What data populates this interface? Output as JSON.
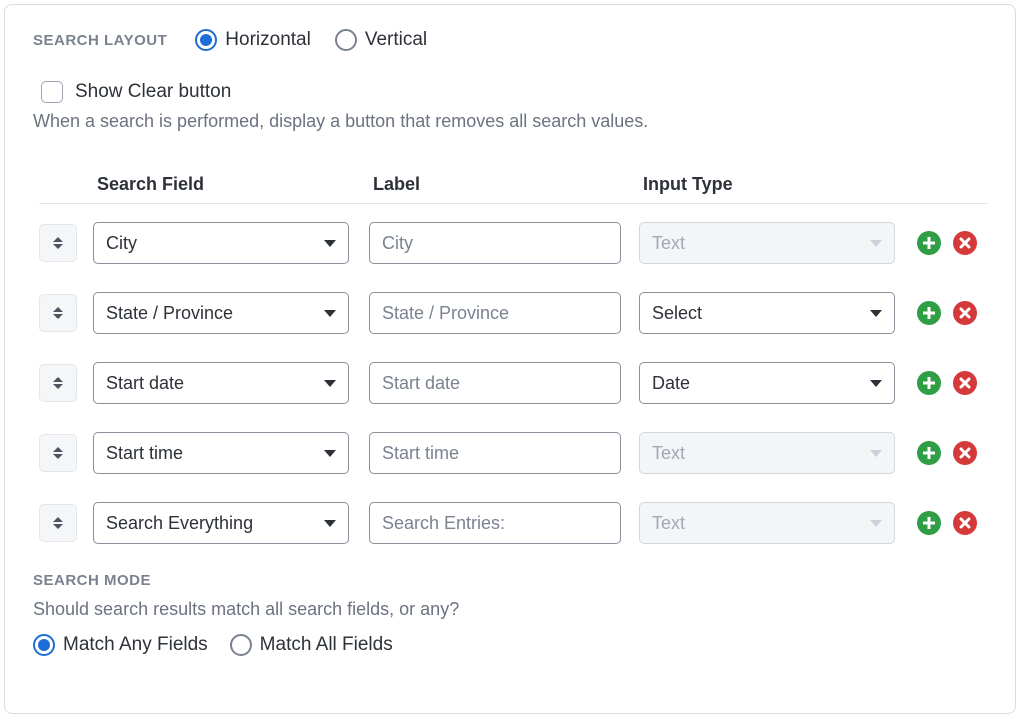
{
  "layout": {
    "section_label": "SEARCH LAYOUT",
    "options": {
      "horizontal": "Horizontal",
      "vertical": "Vertical"
    },
    "selected": "horizontal"
  },
  "clear_button": {
    "label": "Show Clear button",
    "help": "When a search is performed, display a button that removes all search values.",
    "checked": false
  },
  "table": {
    "headers": {
      "field": "Search Field",
      "label": "Label",
      "input_type": "Input Type"
    },
    "rows": [
      {
        "field": "City",
        "label": "City",
        "input_type": "Text",
        "type_disabled": true
      },
      {
        "field": "State / Province",
        "label": "State / Province",
        "input_type": "Select",
        "type_disabled": false
      },
      {
        "field": "Start date",
        "label": "Start date",
        "input_type": "Date",
        "type_disabled": false
      },
      {
        "field": "Start time",
        "label": "Start time",
        "input_type": "Text",
        "type_disabled": true
      },
      {
        "field": "Search Everything",
        "label": "Search Entries:",
        "input_type": "Text",
        "type_disabled": true
      }
    ]
  },
  "mode": {
    "section_label": "SEARCH MODE",
    "help": "Should search results match all search fields, or any?",
    "options": {
      "any": "Match Any Fields",
      "all": "Match All Fields"
    },
    "selected": "any"
  }
}
